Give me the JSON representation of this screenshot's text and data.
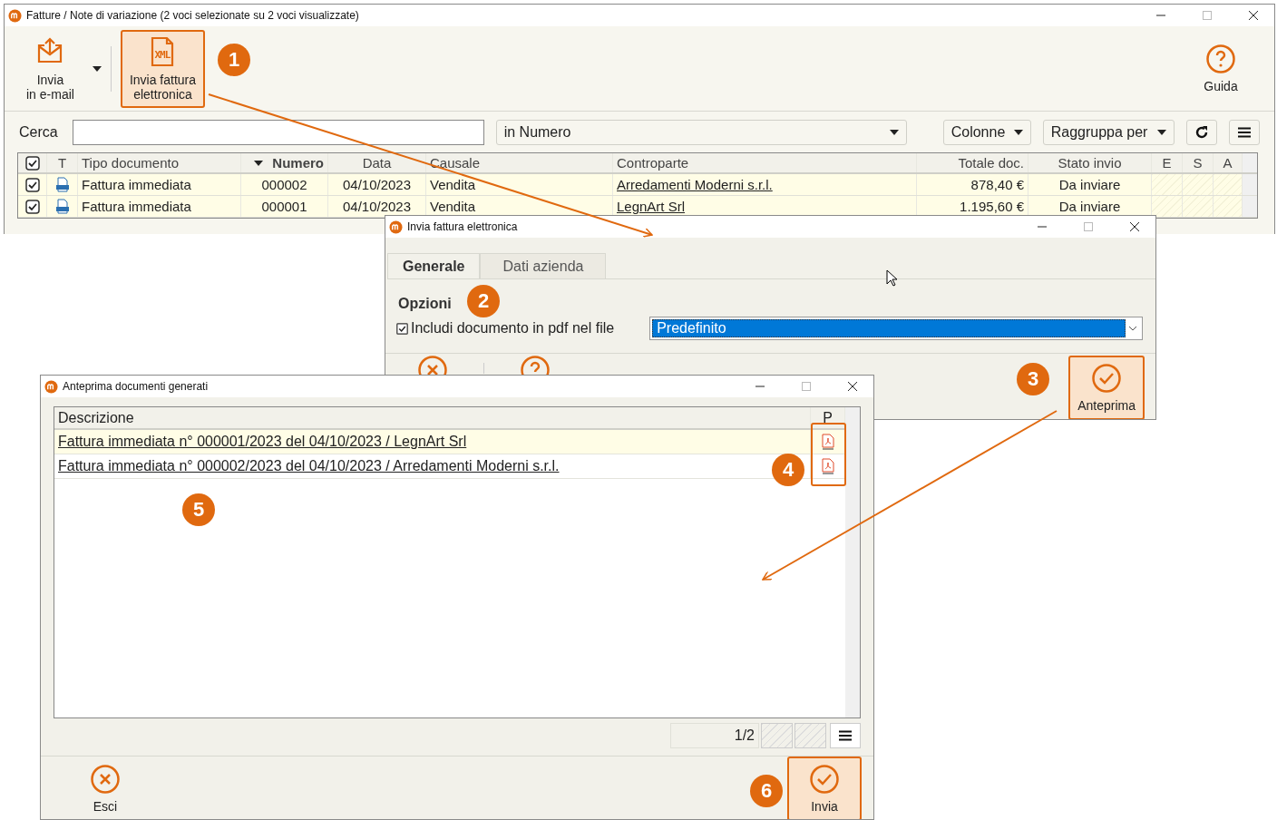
{
  "main_window": {
    "title": "Fatture / Note di variazione (2 voci selezionate su 2 voci visualizzate)",
    "toolbar": [
      {
        "kind": "mail",
        "label": "Invia\nin e-mail",
        "selected": false,
        "dropdown": true
      },
      {
        "kind": "xml",
        "label": "Invia fattura\nelettronica",
        "selected": true,
        "icon_text": "XML"
      }
    ],
    "help": {
      "label": "Guida"
    },
    "search": {
      "label": "Cerca",
      "field": "in Numero",
      "columns": "Colonne",
      "group": "Raggruppa per"
    },
    "table": {
      "all_checked": true,
      "columns": [
        {
          "label": "T",
          "sorted": false
        },
        {
          "label": "Tipo documento",
          "sorted": false
        },
        {
          "label": "Numero",
          "sorted": true
        },
        {
          "label": "Data",
          "sorted": false
        },
        {
          "label": "Causale",
          "sorted": false
        },
        {
          "label": "Controparte",
          "sorted": false
        },
        {
          "label": "Totale doc.",
          "sorted": false
        },
        {
          "label": "Stato invio",
          "sorted": false
        },
        {
          "label": "E",
          "sorted": false
        },
        {
          "label": "S",
          "sorted": false
        },
        {
          "label": "A",
          "sorted": false
        }
      ],
      "rows": [
        {
          "checked": true,
          "tipo": "Fattura immediata",
          "numero": "000002",
          "data": "04/10/2023",
          "causale": "Vendita",
          "controparte": "Arredamenti Moderni s.r.l.",
          "totale": "878,40 €",
          "stato": "Da inviare"
        },
        {
          "checked": true,
          "tipo": "Fattura immediata",
          "numero": "000001",
          "data": "04/10/2023",
          "causale": "Vendita",
          "controparte": "LegnArt Srl",
          "totale": "1.195,60 €",
          "stato": "Da inviare"
        }
      ]
    }
  },
  "invoice_dialog": {
    "title": "Invia fattura elettronica",
    "tabs": [
      {
        "label": "Generale",
        "selected": true
      },
      {
        "label": "Dati azienda",
        "selected": false
      }
    ],
    "section": "Opzioni",
    "checkbox": {
      "label": "Includi documento in pdf nel file",
      "checked": true
    },
    "select": {
      "value": "Predefinito"
    },
    "button": {
      "label": "Anteprima"
    }
  },
  "preview_dialog": {
    "title": "Anteprima documenti generati",
    "columns": [
      "Descrizione",
      "P"
    ],
    "rows": [
      {
        "description": "Fattura immediata n° 000001/2023 del 04/10/2023 / LegnArt Srl",
        "selected": true
      },
      {
        "description": "Fattura immediata n° 000002/2023 del 04/10/2023 / Arredamenti Moderni s.r.l.",
        "selected": false
      }
    ],
    "pager": "1/2",
    "buttons": [
      {
        "kind": "cancel",
        "label": "Esci",
        "highlighted": false
      },
      {
        "kind": "confirm",
        "label": "Invia",
        "highlighted": true
      }
    ]
  },
  "annotations": [
    "1",
    "2",
    "3",
    "4",
    "5",
    "6"
  ]
}
